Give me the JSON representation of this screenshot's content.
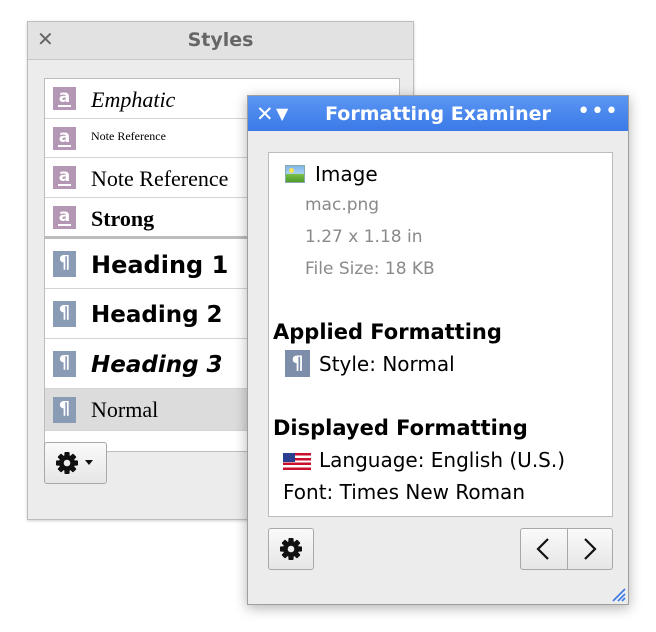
{
  "styles_panel": {
    "title": "Styles",
    "close_glyph": "✕",
    "items": [
      {
        "type": "character",
        "label": "Emphatic",
        "icon_glyph": "a"
      },
      {
        "type": "character",
        "label": "Note Reference",
        "icon_glyph": "a"
      },
      {
        "type": "character",
        "label": "Note Reference",
        "icon_glyph": "a"
      },
      {
        "type": "character",
        "label": "Strong",
        "icon_glyph": "a"
      },
      {
        "type": "paragraph",
        "label": "Heading 1",
        "icon_glyph": "¶"
      },
      {
        "type": "paragraph",
        "label": "Heading 2",
        "icon_glyph": "¶"
      },
      {
        "type": "paragraph",
        "label": "Heading 3",
        "icon_glyph": "¶"
      },
      {
        "type": "paragraph",
        "label": "Normal",
        "icon_glyph": "¶",
        "selected": true
      }
    ],
    "gear_button_icon": "gear-icon"
  },
  "examiner": {
    "title": "Formatting Examiner",
    "close_glyph": "✕",
    "collapse_glyph": "▼",
    "more_glyph": "•••",
    "image": {
      "heading": "Image",
      "filename": "mac.png",
      "dimensions": "1.27 x 1.18 in",
      "file_size": "File Size: 18 KB"
    },
    "applied": {
      "heading": "Applied Formatting",
      "style": "Style: Normal",
      "style_icon_glyph": "¶"
    },
    "displayed": {
      "heading": "Displayed Formatting",
      "language": "Language: English (U.S.)",
      "font": "Font: Times New Roman"
    }
  },
  "colors": {
    "character_style_icon": "#b497b4",
    "paragraph_style_icon": "#8a9bb5",
    "examiner_titlebar": "#4a88ee",
    "selected_row": "#dcdcdc"
  }
}
